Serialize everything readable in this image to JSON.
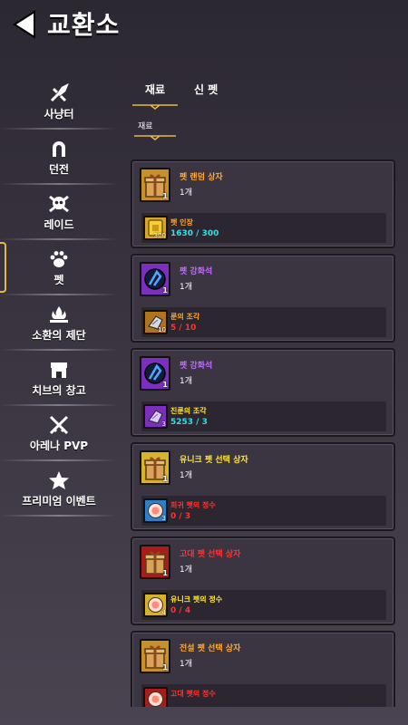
{
  "header": {
    "title": "교환소"
  },
  "sidebar": {
    "items": [
      {
        "label": "사냥터",
        "icon": "hunting-icon"
      },
      {
        "label": "던전",
        "icon": "dungeon-magnet-icon"
      },
      {
        "label": "레이드",
        "icon": "skull-icon"
      },
      {
        "label": "펫",
        "icon": "paw-icon"
      },
      {
        "label": "소환의 제단",
        "icon": "altar-icon"
      },
      {
        "label": "치브의 창고",
        "icon": "shop-icon"
      },
      {
        "label": "아레나 PVP",
        "icon": "crossed-swords-icon"
      },
      {
        "label": "프리미엄 이벤트",
        "icon": "star-icon"
      }
    ],
    "active_index": 3
  },
  "tabs": {
    "items": [
      "재료",
      "신 펫"
    ],
    "active": "재료",
    "subtab": "재료"
  },
  "colors": {
    "orange": "#ffa733",
    "purple": "#c06bff",
    "yellow": "#ffe433",
    "red": "#ff3333",
    "cyan": "#33dfe6",
    "accent": "#e6b840"
  },
  "exchanges": [
    {
      "name": "펫 랜덤 상자",
      "name_color": "#ffa733",
      "count": "1개",
      "qty": "1",
      "icon": "gift-box-icon",
      "frame": "#c8902a",
      "cost": {
        "name": "펫 인장",
        "name_color": "#ffa733",
        "progress": "1630 / 300",
        "progress_color": "#33dfe6",
        "qty": "300",
        "icon": "gold-seal-icon",
        "frame": "#d7a52b"
      }
    },
    {
      "name": "펫 강화석",
      "name_color": "#c06bff",
      "count": "1개",
      "qty": "1",
      "icon": "blue-orb-icon",
      "frame": "#7c2fbf",
      "cost": {
        "name": "룬의 조각",
        "name_color": "#ffa733",
        "progress": "5 / 10",
        "progress_color": "#ff3333",
        "qty": "10",
        "icon": "rune-fragment-icon",
        "frame": "#b0741f"
      }
    },
    {
      "name": "펫 강화석",
      "name_color": "#c06bff",
      "count": "1개",
      "qty": "1",
      "icon": "blue-orb-icon",
      "frame": "#7c2fbf",
      "cost": {
        "name": "진룬의 조각",
        "name_color": "#ffe433",
        "progress": "5253 / 3",
        "progress_color": "#33dfe6",
        "qty": "3",
        "icon": "true-rune-fragment-icon",
        "frame": "#7c2fbf"
      }
    },
    {
      "name": "유니크 펫 선택 상자",
      "name_color": "#ffe433",
      "count": "1개",
      "qty": "1",
      "icon": "gift-box-icon",
      "frame": "#d7b22b",
      "cost": {
        "name": "희귀 펫의 정수",
        "name_color": "#ff3333",
        "progress": "0 / 3",
        "progress_color": "#ff3333",
        "qty": "3",
        "icon": "rare-essence-icon",
        "frame": "#2f7fc8"
      }
    },
    {
      "name": "고대 펫 선택 상자",
      "name_color": "#ff3333",
      "count": "1개",
      "qty": "1",
      "icon": "gift-box-icon",
      "frame": "#a81c1c",
      "cost": {
        "name": "유니크 펫의 정수",
        "name_color": "#ffe433",
        "progress": "0 / 4",
        "progress_color": "#ff3333",
        "qty": "4",
        "icon": "unique-essence-icon",
        "frame": "#d7b22b"
      }
    },
    {
      "name": "전설 펫 선택 상자",
      "name_color": "#ffa733",
      "count": "1개",
      "qty": "1",
      "icon": "gift-box-icon",
      "frame": "#c8902a",
      "cost": {
        "name": "고대 펫의 정수",
        "name_color": "#ff3333",
        "progress": "",
        "progress_color": "#ff3333",
        "qty": "",
        "icon": "ancient-essence-icon",
        "frame": "#a81c1c"
      }
    }
  ]
}
